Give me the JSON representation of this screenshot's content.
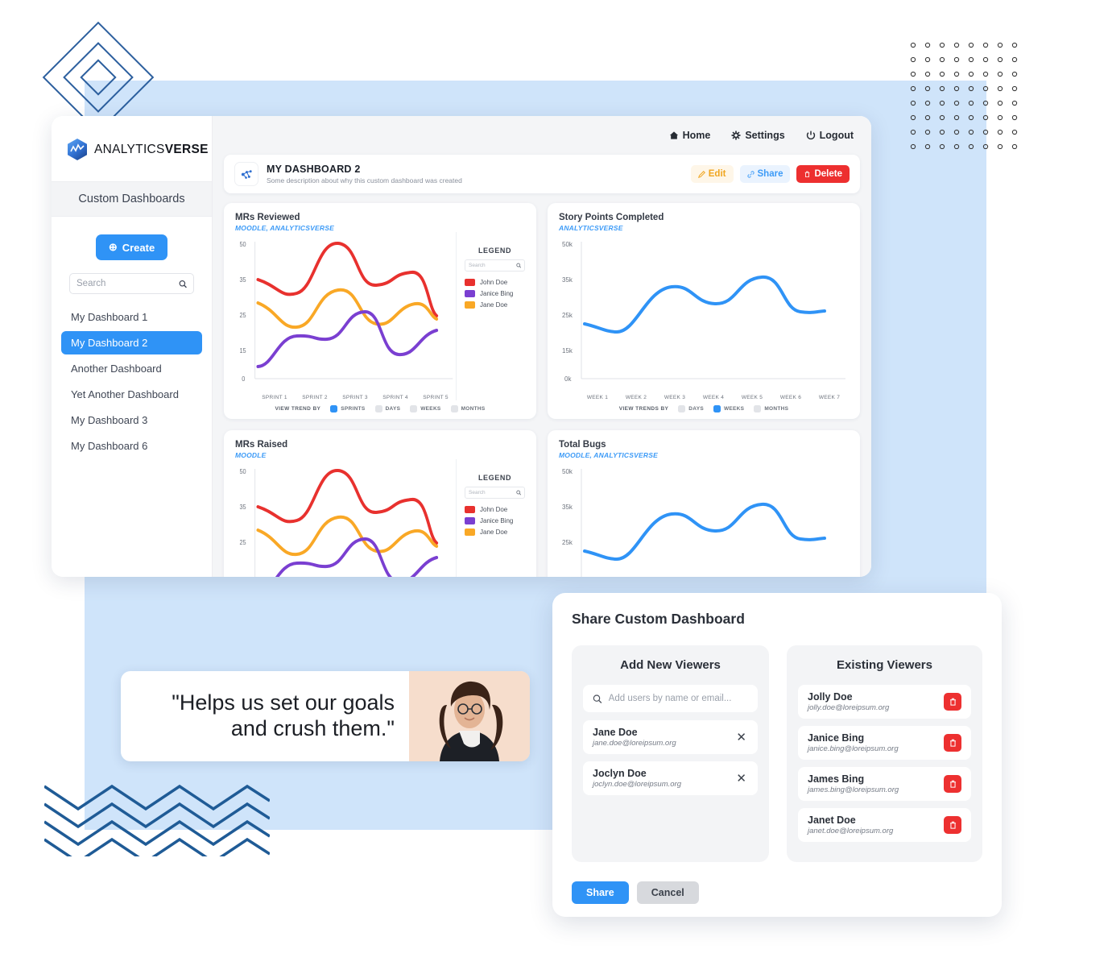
{
  "brand": {
    "name_light": "ANALYTICS",
    "name_bold": "VERSE"
  },
  "topbar": [
    {
      "label": "Home",
      "icon": "home-icon"
    },
    {
      "label": "Settings",
      "icon": "gear-icon"
    },
    {
      "label": "Logout",
      "icon": "power-icon"
    }
  ],
  "sidebar": {
    "section_title": "Custom Dashboards",
    "create_label": "Create",
    "search_placeholder": "Search",
    "items": [
      {
        "label": "My Dashboard 1",
        "active": false
      },
      {
        "label": "My Dashboard 2",
        "active": true
      },
      {
        "label": "Another Dashboard",
        "active": false
      },
      {
        "label": "Yet Another Dashboard",
        "active": false
      },
      {
        "label": "My Dashboard 3",
        "active": false
      },
      {
        "label": "My Dashboard 6",
        "active": false
      }
    ]
  },
  "dashboard_header": {
    "title": "MY DASHBOARD 2",
    "description": "Some description about why this custom dashboard was created",
    "edit_label": "Edit",
    "share_label": "Share",
    "delete_label": "Delete"
  },
  "legend": {
    "title": "LEGEND",
    "search_placeholder": "Search"
  },
  "colors": {
    "accent_blue": "#2f93f6",
    "series_red": "#e8312e",
    "series_purple": "#7a3fd1",
    "series_orange": "#f9a826",
    "series_line_blue": "#2f93f6",
    "delete_red": "#ed2f2f",
    "edit_orange": "#f0a621",
    "panel_blue": "#cfe4fa"
  },
  "chart_data": [
    {
      "type": "line",
      "title": "MRs Reviewed",
      "subtitle": "MOODLE, ANALYTICSVERSE",
      "xlabel": "",
      "ylabel": "",
      "categories": [
        "SPRINT 1",
        "SPRINT 2",
        "SPRINT 3",
        "SPRINT 4",
        "SPRINT 5"
      ],
      "ytick_labels": [
        "50",
        "35",
        "25",
        "15",
        "0"
      ],
      "ylim": [
        0,
        50
      ],
      "grid": false,
      "legend_position": "right",
      "trend_label": "VIEW TREND BY",
      "trend_options": [
        {
          "label": "SPRINTS",
          "active": true
        },
        {
          "label": "DAYS",
          "active": false
        },
        {
          "label": "WEEKS",
          "active": false
        },
        {
          "label": "MONTHS",
          "active": false
        }
      ],
      "series": [
        {
          "name": "John Doe",
          "color": "#e8312e",
          "values": [
            38,
            33,
            49,
            37,
            39,
            26
          ]
        },
        {
          "name": "Janice Bing",
          "color": "#7a3fd1",
          "values": [
            8,
            20,
            19,
            26,
            15,
            19
          ]
        },
        {
          "name": "Jane Doe",
          "color": "#f9a826",
          "values": [
            23,
            22,
            32,
            30,
            34,
            28
          ]
        }
      ]
    },
    {
      "type": "line",
      "title": "Story Points Completed",
      "subtitle": "ANALYTICSVERSE",
      "xlabel": "",
      "ylabel": "",
      "categories": [
        "WEEK 1",
        "WEEK 2",
        "WEEK 3",
        "WEEK 4",
        "WEEK 5",
        "WEEK 6",
        "WEEK 7"
      ],
      "ytick_labels": [
        "50k",
        "35k",
        "25k",
        "15k",
        "0k"
      ],
      "ylim": [
        0,
        50000
      ],
      "grid": false,
      "legend_position": "none",
      "trend_label": "VIEW TRENDS BY",
      "trend_options": [
        {
          "label": "DAYS",
          "active": false
        },
        {
          "label": "WEEKS",
          "active": true
        },
        {
          "label": "MONTHS",
          "active": false
        }
      ],
      "series": [
        {
          "name": "Story Points",
          "color": "#2f93f6",
          "values": [
            23500,
            22000,
            29000,
            33000,
            30500,
            34000,
            28500
          ]
        }
      ]
    },
    {
      "type": "line",
      "title": "MRs Raised",
      "subtitle": "MOODLE",
      "xlabel": "",
      "ylabel": "",
      "categories": [],
      "ytick_labels": [
        "50",
        "35",
        "25"
      ],
      "ylim": [
        0,
        50
      ],
      "grid": false,
      "legend_position": "right",
      "series": [
        {
          "name": "John Doe",
          "color": "#e8312e",
          "values": [
            38,
            33,
            49,
            37,
            39,
            26
          ]
        },
        {
          "name": "Janice Bing",
          "color": "#7a3fd1",
          "values": [
            8,
            20,
            19,
            26,
            15,
            19
          ]
        },
        {
          "name": "Jane Doe",
          "color": "#f9a826",
          "values": [
            23,
            22,
            32,
            30,
            34,
            28
          ]
        }
      ]
    },
    {
      "type": "line",
      "title": "Total Bugs",
      "subtitle": "MOODLE, ANALYTICSVERSE",
      "xlabel": "",
      "ylabel": "",
      "categories": [],
      "ytick_labels": [
        "50k",
        "35k",
        "25k"
      ],
      "ylim": [
        0,
        50000
      ],
      "grid": false,
      "legend_position": "none",
      "series": [
        {
          "name": "Total Bugs",
          "color": "#2f93f6",
          "values": [
            23500,
            22000,
            29000,
            33000,
            30500,
            34000,
            28500
          ]
        }
      ]
    }
  ],
  "chart_legend_series": [
    {
      "name": "John Doe",
      "color": "#e8312e"
    },
    {
      "name": "Janice Bing",
      "color": "#7a3fd1"
    },
    {
      "name": "Jane Doe",
      "color": "#f9a826"
    }
  ],
  "testimonial": {
    "line1": "\"Helps us set our goals",
    "line2": "and crush them.\""
  },
  "share_dialog": {
    "title": "Share Custom Dashboard",
    "add_panel_title": "Add New Viewers",
    "existing_panel_title": "Existing Viewers",
    "add_search_placeholder": "Add users by name or email...",
    "new_viewers": [
      {
        "name": "Jane Doe",
        "email": "jane.doe@loreipsum.org"
      },
      {
        "name": "Joclyn Doe",
        "email": "joclyn.doe@loreipsum.org"
      }
    ],
    "existing_viewers": [
      {
        "name": "Jolly Doe",
        "email": "jolly.doe@loreipsum.org"
      },
      {
        "name": "Janice Bing",
        "email": "janice.bing@loreipsum.org"
      },
      {
        "name": "James Bing",
        "email": "james.bing@loreipsum.org"
      },
      {
        "name": "Janet Doe",
        "email": "janet.doe@loreipsum.org"
      }
    ],
    "share_label": "Share",
    "cancel_label": "Cancel"
  }
}
